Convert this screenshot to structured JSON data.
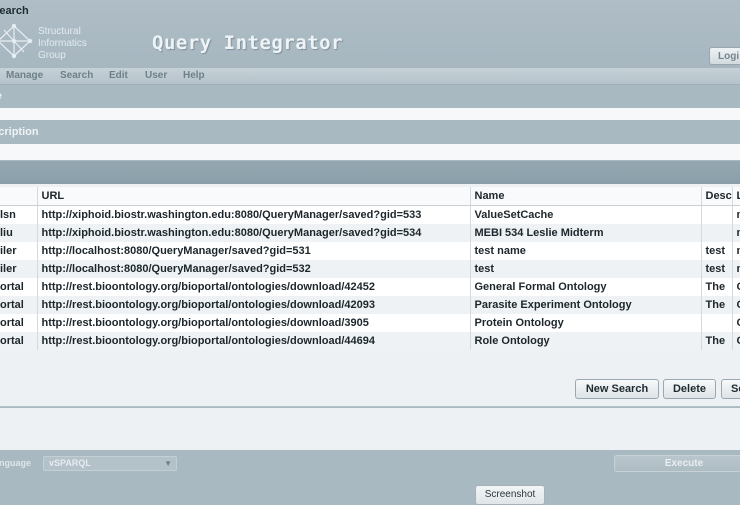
{
  "header": {
    "org_line1": "Structural",
    "org_line2": "Informatics",
    "org_line3": "Group",
    "app_title": "Query Integrator",
    "login_label": "Logi"
  },
  "menu": [
    "Manage",
    "Search",
    "Edit",
    "User",
    "Help"
  ],
  "form": {
    "title_label": "itle",
    "description_label": "escription"
  },
  "search": {
    "title": "Search",
    "columns": [
      "",
      "URL",
      "Name",
      "Desc",
      "L"
    ],
    "rows": [
      [
        "lsn",
        "http://xiphoid.biostr.washington.edu:8080/QueryManager/saved?gid=533",
        "ValueSetCache",
        "",
        "n"
      ],
      [
        "liu",
        "http://xiphoid.biostr.washington.edu:8080/QueryManager/saved?gid=534",
        "MEBI 534 Leslie Midterm",
        "",
        "n"
      ],
      [
        "iler",
        "http://localhost:8080/QueryManager/saved?gid=531",
        "test name",
        "test",
        "n"
      ],
      [
        "iler",
        "http://localhost:8080/QueryManager/saved?gid=532",
        "test",
        "test",
        "n"
      ],
      [
        "ortal",
        "http://rest.bioontology.org/bioportal/ontologies/download/42452",
        "General Formal Ontology",
        "The",
        "C"
      ],
      [
        "ortal",
        "http://rest.bioontology.org/bioportal/ontologies/download/42093",
        "Parasite Experiment Ontology",
        "The",
        "C"
      ],
      [
        "ortal",
        "http://rest.bioontology.org/bioportal/ontologies/download/3905",
        "Protein Ontology",
        "",
        "C"
      ],
      [
        "ortal",
        "http://rest.bioontology.org/bioportal/ontologies/download/44694",
        "Role Ontology",
        "The",
        "C"
      ]
    ],
    "new_search_label": "New Search",
    "delete_label": "Delete",
    "select_label": "Se"
  },
  "query": {
    "language_label": "anguage",
    "language_value": "vSPARQL",
    "execute_label": "Execute",
    "screenshot_label": "Screenshot"
  },
  "icons": {
    "logo": "network-graph-icon",
    "dropdown": "chevron-down-icon"
  },
  "colors": {
    "header_bg": "#a9b9c2",
    "panel_bg": "#eef1f3",
    "table_alt_row": "#eef2f4",
    "search_header": "#8fa3ad"
  }
}
